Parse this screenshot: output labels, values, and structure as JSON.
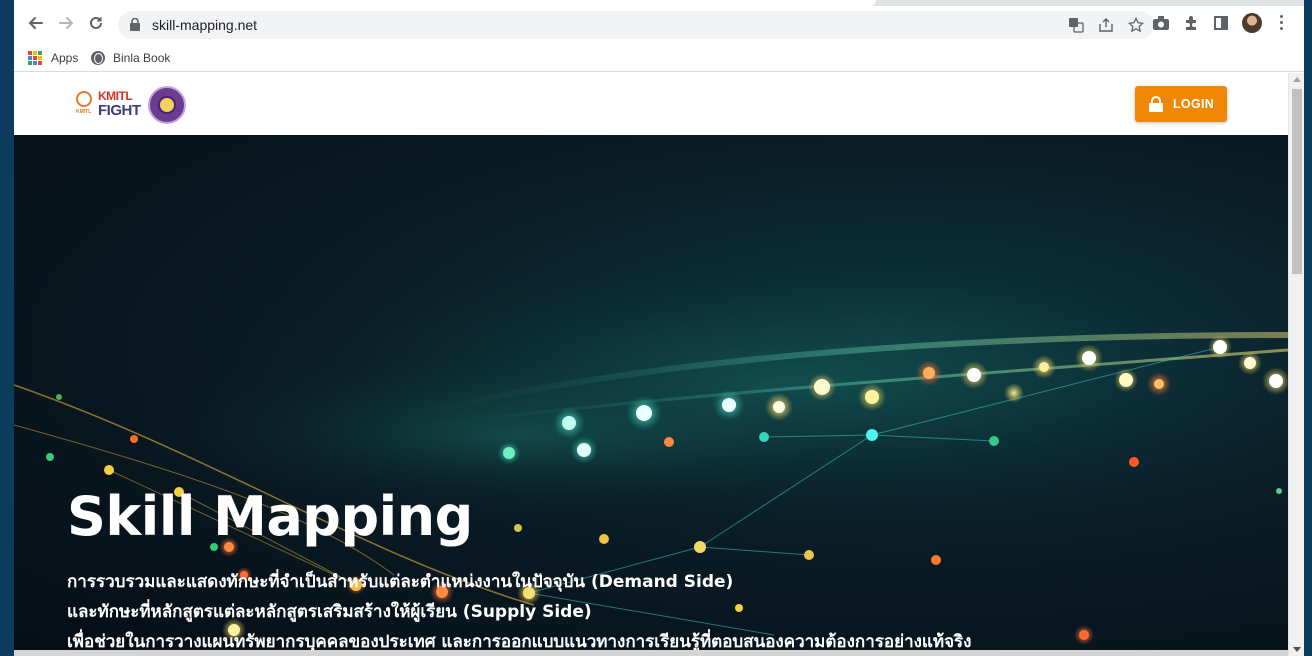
{
  "browser": {
    "url": "skill-mapping.net",
    "bookmarks": [
      {
        "label": "Apps",
        "icon": "apps-grid-icon"
      },
      {
        "label": "Binla Book",
        "icon": "globe-icon"
      }
    ],
    "apps_colors": [
      "#ea4335",
      "#fbbc04",
      "#34a853",
      "#4285f4",
      "#ea4335",
      "#fbbc04",
      "#34a853",
      "#4285f4",
      "#ea4335"
    ]
  },
  "site": {
    "logo_line1": "KMITL",
    "logo_line2": "FIGHT",
    "logo_small": "KMITL",
    "login_label": "LOGIN",
    "accent_color": "#f28705"
  },
  "hero": {
    "title": "Skill Mapping",
    "lines": [
      "การรวบรวมและแสดงทักษะที่จำเป็นสำหรับแต่ละตำแหน่งงานในปัจจุบัน (Demand Side)",
      "และทักษะที่หลักสูตรแต่ละหลักสูตรเสริมสร้างให้ผู้เรียน (Supply Side)",
      "เพื่อช่วยในการวางแผนทรัพยากรบุคคลของประเทศ และการออกแบบแนวทางการเรียนรู้ที่ตอบสนองความต้องการอย่างแท้จริง"
    ]
  }
}
